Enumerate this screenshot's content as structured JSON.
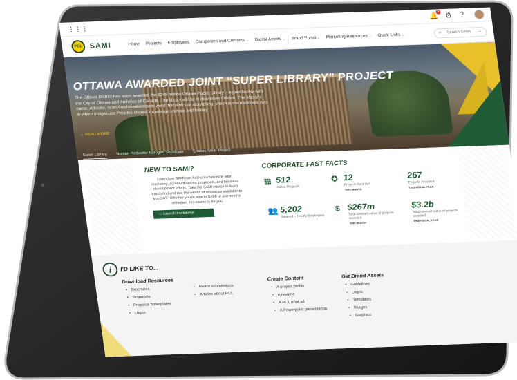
{
  "topbar": {
    "grid_icon": "grid-icon",
    "bell_badge": "9"
  },
  "nav": {
    "logo_text": "PCL",
    "brand": "SAMI",
    "links": [
      "Home",
      "Projects",
      "Employees",
      "Companies and Contacts",
      "Digital Assets",
      "Brand Portal",
      "Marketing Resources",
      "Quick Links"
    ],
    "search_placeholder": "Search SAMI"
  },
  "hero": {
    "title": "OTTAWA AWARDED JOINT “SUPER LIBRARY” PROJECT",
    "body": "The Ottawa District has been awarded the $248 million Ottawa Public Library – a joint facility with the City of Ottawa and Archives of Canada. The library will be in downtown Ottawa. The library’s name, Adisoke, is an Anishinaabemowin word that refers to storytelling, which is the traditional way in which Indigenous Peoples shared knowledge, culture and history.",
    "read_more": "READ MORE",
    "tabs": [
      "Super Library",
      "Nutrien Redwater Nitrogen Shutdown",
      "Shakes Solar Project"
    ]
  },
  "new_to_sami": {
    "title": "NEW TO SAMI?",
    "body": "Learn how SAMI can help you maximize your marketing, communications, proposals, and business development efforts. Take the SAMI course to learn how to find and use the wealth of resources available to you 24/7. Whether you’re new to SAMI or just need a refresher, this course is for you.",
    "button": "Launch the tutorial"
  },
  "fast_facts": {
    "title": "CORPORATE FAST FACTS",
    "items": [
      {
        "value": "512",
        "label": "Active Projects",
        "sub": ""
      },
      {
        "value": "12",
        "label": "Projects Awarded",
        "sub": "THIS MONTH"
      },
      {
        "value": "267",
        "label": "Projects Awarded",
        "sub": "THIS FISCAL YEAR"
      },
      {
        "value": "5,202",
        "label": "Salaried + Hourly Employees",
        "sub": ""
      },
      {
        "value": "$267m",
        "label": "Total contract value of projects awarded",
        "sub": "THIS MONTH"
      },
      {
        "value": "$3.2b",
        "label": "Total contract value of projects awarded",
        "sub": "THIS FISCAL YEAR"
      }
    ]
  },
  "like_to": {
    "title": "I'D LIKE TO...",
    "download": {
      "title": "Download Resources",
      "col1": [
        "Brochures",
        "Proposals",
        "Proposal boilerplates",
        "Logos"
      ],
      "col2": [
        "Award submissions",
        "Articles about PCL"
      ]
    },
    "create": {
      "title": "Create Content",
      "items": [
        "A project profile",
        "A resume",
        "A PCL print ad",
        "A Powerpoint presentation"
      ]
    },
    "brand": {
      "title": "Get Brand Assets",
      "items": [
        "Guidelines",
        "Logos",
        "Templates",
        "Images",
        "Graphics"
      ]
    }
  }
}
